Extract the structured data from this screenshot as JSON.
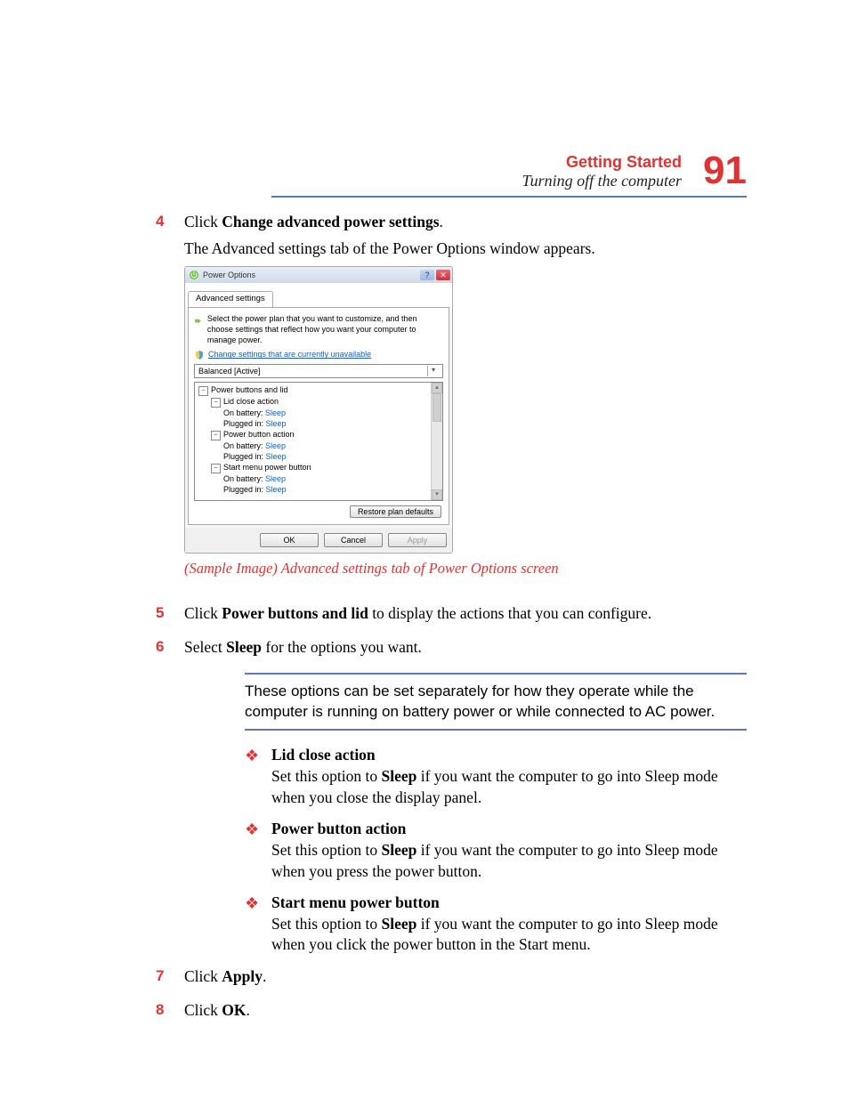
{
  "header": {
    "section": "Getting Started",
    "sub": "Turning off the computer",
    "page": "91"
  },
  "steps": {
    "s4_num": "4",
    "s4_a": "Click ",
    "s4_b": "Change advanced power settings",
    "s4_c": ".",
    "s4_sub": "The Advanced settings tab of the Power Options window appears.",
    "caption": "(Sample Image) Advanced settings tab of Power Options screen",
    "s5_num": "5",
    "s5_a": "Click ",
    "s5_b": "Power buttons and lid",
    "s5_c": " to display the actions that you can configure.",
    "s6_num": "6",
    "s6_a": "Select ",
    "s6_b": "Sleep",
    "s6_c": " for the options you want.",
    "note": "These options can be set separately for how they operate while the computer is running on battery power or while connected to AC power.",
    "b1_t": "Lid close action",
    "b1_a": "Set this option to ",
    "b1_b": "Sleep",
    "b1_c": " if you want the computer to go into Sleep mode when you close the display panel.",
    "b2_t": "Power button action",
    "b2_a": "Set this option to ",
    "b2_b": "Sleep",
    "b2_c": " if you want the computer to go into Sleep mode when you press the power button.",
    "b3_t": "Start menu power button",
    "b3_a": "Set this option to ",
    "b3_b": "Sleep",
    "b3_c": " if you want the computer to go into Sleep mode when you click the power button in the Start menu.",
    "s7_num": "7",
    "s7_a": "Click ",
    "s7_b": "Apply",
    "s7_c": ".",
    "s8_num": "8",
    "s8_a": "Click ",
    "s8_b": "OK",
    "s8_c": "."
  },
  "dialog": {
    "title": "Power Options",
    "help_glyph": "?",
    "close_glyph": "✕",
    "tab_label": "Advanced settings",
    "intro": "Select the power plan that you want to customize, and then choose settings that reflect how you want your computer to manage power.",
    "link": "Change settings that are currently unavailable",
    "plan": "Balanced [Active]",
    "tree": {
      "root": "Power buttons and lid",
      "g1": "Lid close action",
      "g1_on_batt_l": "On battery: ",
      "g1_on_batt_v": "Sleep",
      "g1_plug_l": "Plugged in: ",
      "g1_plug_v": "Sleep",
      "g2": "Power button action",
      "g2_on_batt_l": "On battery: ",
      "g2_on_batt_v": "Sleep",
      "g2_plug_l": "Plugged in: ",
      "g2_plug_v": "Sleep",
      "g3": "Start menu power button",
      "g3_on_batt_l": "On battery: ",
      "g3_on_batt_v": "Sleep",
      "g3_plug_l": "Plugged in: ",
      "g3_plug_v": "Sleep"
    },
    "restore": "Restore plan defaults",
    "ok": "OK",
    "cancel": "Cancel",
    "apply": "Apply",
    "minus": "−",
    "arrow_down": "▾",
    "arrow_up": "▴"
  }
}
